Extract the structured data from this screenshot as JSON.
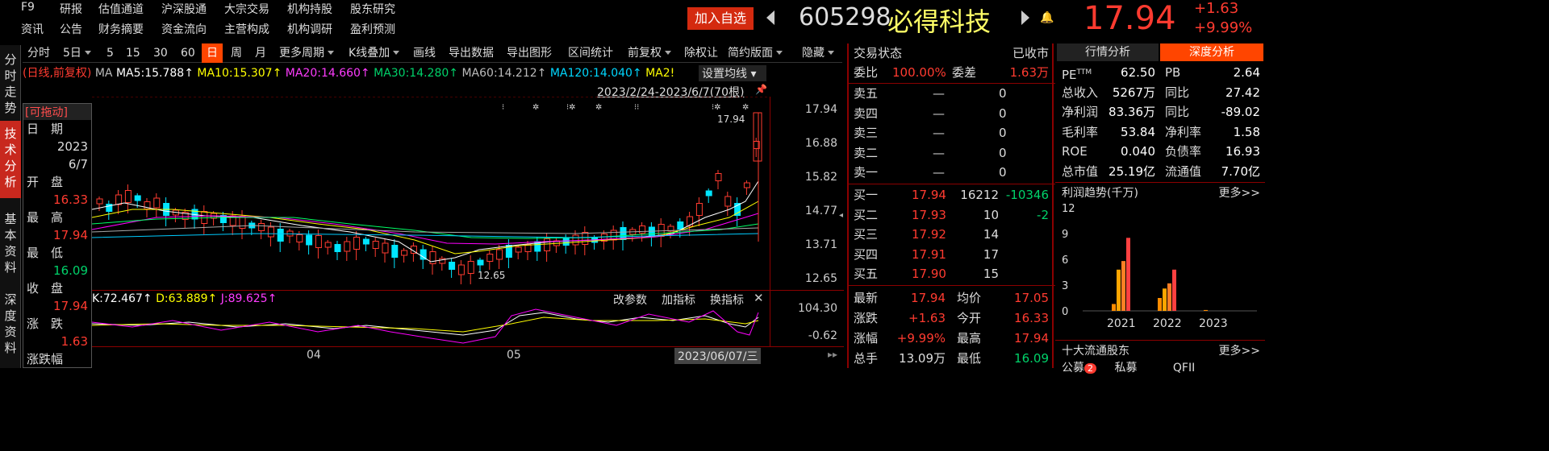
{
  "topnav": {
    "row1": [
      "F9",
      "研报",
      "估值通道",
      "沪深股通",
      "大宗交易",
      "机构持股",
      "股东研究"
    ],
    "row2": [
      "资讯",
      "公告",
      "财务摘要",
      "资金流向",
      "主营构成",
      "机构调研",
      "盈利预测"
    ]
  },
  "header": {
    "add_watch": "加入自选",
    "code": "605298",
    "name": "必得科技",
    "price": "17.94",
    "change": "+1.63",
    "pct": "+9.99%"
  },
  "left_tabs": [
    "分时走势",
    "技术分析",
    "基本资料",
    "深度资料"
  ],
  "toolbar": [
    "分时",
    "5日",
    "5",
    "15",
    "30",
    "60",
    "日",
    "周",
    "月",
    "更多周期",
    "K线叠加",
    "画线",
    "导出数据",
    "导出图形",
    "区间统计",
    "前复权",
    "除权让",
    "简约版面",
    "隐藏"
  ],
  "ma_line": {
    "prefix": "(日线,前复权)",
    "ma": "MA",
    "ma5": "MA5:15.788↑",
    "ma10": "MA10:15.307↑",
    "ma20": "MA20:14.660↑",
    "ma30": "MA30:14.280↑",
    "ma60": "MA60:14.212↑",
    "ma120": "MA120:14.040↑",
    "ma250": "MA2!"
  },
  "chart": {
    "setting": "设置均线",
    "range": "2023/2/24-2023/6/7(70根)",
    "y_labels": [
      "17.94",
      "16.88",
      "15.82",
      "14.77",
      "13.71",
      "12.65"
    ],
    "high_mark": "17.94",
    "low_mark": "12.65",
    "kdj_labels": {
      "k": "K:72.467↑",
      "d": "D:63.889↑",
      "j": "J:89.625↑"
    },
    "kdj_buttons": [
      "改参数",
      "加指标",
      "换指标"
    ],
    "kdj_y": [
      "104.30",
      "-0.62"
    ],
    "x_labels": [
      "04",
      "05"
    ],
    "cursor_date": "2023/06/07/三"
  },
  "popup": {
    "title": "[可拖动]",
    "fields": [
      {
        "label": "日　期",
        "value": "2023"
      },
      {
        "label": "",
        "value": "6/7"
      },
      {
        "label": "开　盘",
        "value": "16.33"
      },
      {
        "label": "最　高",
        "value": "17.94"
      },
      {
        "label": "最　低",
        "value": "16.09"
      },
      {
        "label": "收　盘",
        "value": "17.94"
      },
      {
        "label": "涨　跌",
        "value": "1.63"
      },
      {
        "label": "涨跌幅",
        "value": ""
      }
    ]
  },
  "trade": {
    "status_label": "交易状态",
    "status": "已收市",
    "weibi_label": "委比",
    "weibi": "100.00%",
    "weicha_label": "委差",
    "weicha": "1.63万",
    "sell": [
      {
        "l": "卖五",
        "p": "—",
        "v": "0"
      },
      {
        "l": "卖四",
        "p": "—",
        "v": "0"
      },
      {
        "l": "卖三",
        "p": "—",
        "v": "0"
      },
      {
        "l": "卖二",
        "p": "—",
        "v": "0"
      },
      {
        "l": "卖一",
        "p": "—",
        "v": "0"
      }
    ],
    "buy": [
      {
        "l": "买一",
        "p": "17.94",
        "v": "16212",
        "d": "-10346"
      },
      {
        "l": "买二",
        "p": "17.93",
        "v": "10",
        "d": "-2"
      },
      {
        "l": "买三",
        "p": "17.92",
        "v": "14",
        "d": ""
      },
      {
        "l": "买四",
        "p": "17.91",
        "v": "17",
        "d": ""
      },
      {
        "l": "买五",
        "p": "17.90",
        "v": "15",
        "d": ""
      }
    ],
    "stats": [
      {
        "l1": "最新",
        "v1": "17.94",
        "l2": "均价",
        "v2": "17.05"
      },
      {
        "l1": "涨跌",
        "v1": "+1.63",
        "l2": "今开",
        "v2": "16.33"
      },
      {
        "l1": "涨幅",
        "v1": "+9.99%",
        "l2": "最高",
        "v2": "17.94"
      },
      {
        "l1": "总手",
        "v1": "13.09万",
        "l2": "最低",
        "v2": "16.09"
      }
    ]
  },
  "right": {
    "tabs": [
      "行情分析",
      "深度分析"
    ],
    "metrics": [
      {
        "l1": "PE",
        "sup": "TTM",
        "v1": "62.50",
        "l2": "PB",
        "v2": "2.64"
      },
      {
        "l1": "总收入",
        "v1": "5267万",
        "l2": "同比",
        "v2": "27.42"
      },
      {
        "l1": "净利润",
        "v1": "83.36万",
        "l2": "同比",
        "v2": "-89.02"
      },
      {
        "l1": "毛利率",
        "v1": "53.84",
        "l2": "净利率",
        "v2": "1.58"
      },
      {
        "l1": "ROE",
        "v1": "0.040",
        "l2": "负债率",
        "v2": "16.93"
      },
      {
        "l1": "总市值",
        "v1": "25.19亿",
        "l2": "流通值",
        "v2": "7.70亿"
      }
    ],
    "profit_title": "利润趋势(千万)",
    "more": "更多>>",
    "y_ticks": [
      "12",
      "9",
      "6",
      "3",
      "0"
    ],
    "years": [
      "2021",
      "2022",
      "2023"
    ],
    "top10_title": "十大流通股东",
    "top10_more": "更多>>",
    "bottom_tabs": [
      "公募",
      "私募",
      "QFII"
    ],
    "bottom_badge": "2"
  },
  "colors": {
    "accent": "#ff3b30",
    "up": "#ff3b30",
    "down": "#00e5ff",
    "panel_border": "#8b0000",
    "active_tab": "#ff4500"
  },
  "chart_data": [
    {
      "type": "bar",
      "title": "利润趋势(千万)",
      "categories": [
        "2021",
        "2022",
        "2023"
      ],
      "ylim": [
        0,
        12
      ],
      "series": [
        {
          "values": [
            0.8,
            1.5,
            0.1
          ]
        },
        {
          "values": [
            4.8,
            2.6,
            0
          ]
        },
        {
          "values": [
            5.8,
            3.2,
            0
          ]
        },
        {
          "values": [
            8.5,
            4.8,
            0
          ]
        }
      ]
    }
  ]
}
